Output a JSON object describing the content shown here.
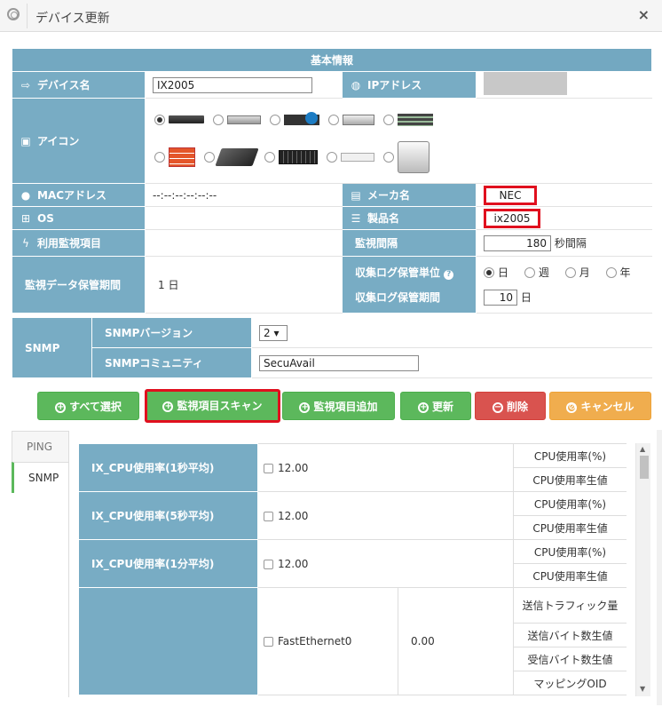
{
  "window": {
    "title": "デバイス更新",
    "close": "×"
  },
  "info": {
    "header": "基本情報",
    "device_name_label": "デバイス名",
    "device_name_value": "IX2005",
    "ip_label": "IPアドレス",
    "icon_label": "アイコン",
    "mac_label": "MACアドレス",
    "mac_value": "--:--:--:--:--:--",
    "maker_label": "メーカ名",
    "maker_value": "NEC",
    "os_label": "OS",
    "product_label": "製品名",
    "product_value": "ix2005",
    "monitor_items_label": "利用監視項目",
    "interval_label": "監視間隔",
    "interval_value": "180",
    "interval_unit": "秒間隔",
    "retention_label": "監視データ保管期間",
    "retention_value": "1 日",
    "log_unit_label": "収集ログ保管単位",
    "log_unit_options": [
      "日",
      "週",
      "月",
      "年"
    ],
    "log_period_label": "収集ログ保管期間",
    "log_period_value": "10",
    "log_period_unit": "日",
    "snmp_label": "SNMP",
    "snmp_version_label": "SNMPバージョン",
    "snmp_version_value": "2 ▾",
    "snmp_community_label": "SNMPコミュニティ",
    "snmp_community_value": "SecuAvail"
  },
  "buttons": {
    "select_all": "すべて選択",
    "scan": "監視項目スキャン",
    "add": "監視項目追加",
    "update": "更新",
    "delete": "削除",
    "cancel": "キャンセル"
  },
  "tabs": [
    "PING",
    "SNMP"
  ],
  "monitors": [
    {
      "name": "IX_CPU使用率(1秒平均)",
      "value": "12.00",
      "subs": [
        "CPU使用率(%)",
        "CPU使用率生値"
      ]
    },
    {
      "name": "IX_CPU使用率(5秒平均)",
      "value": "12.00",
      "subs": [
        "CPU使用率(%)",
        "CPU使用率生値"
      ]
    },
    {
      "name": "IX_CPU使用率(1分平均)",
      "value": "12.00",
      "subs": [
        "CPU使用率(%)",
        "CPU使用率生値"
      ]
    },
    {
      "name": "",
      "value": "FastEthernet0",
      "value2": "0.00",
      "subs": [
        "送信トラフィック量",
        "送信バイト数生値",
        "受信バイト数生値",
        "マッピングOID"
      ]
    }
  ]
}
